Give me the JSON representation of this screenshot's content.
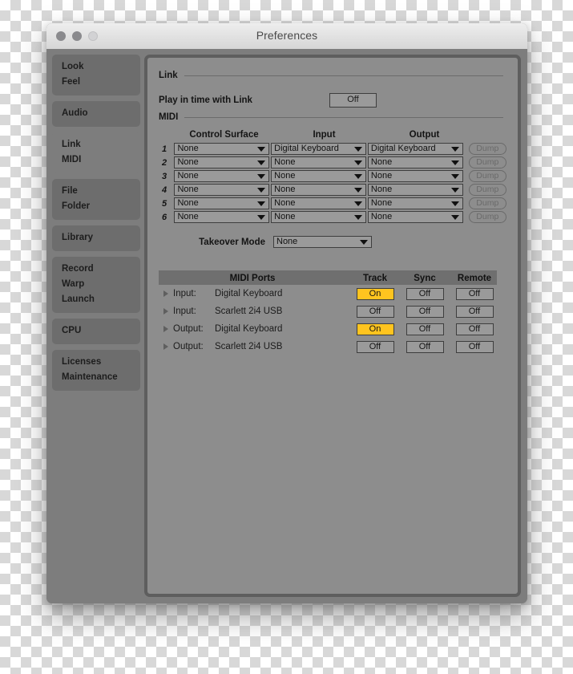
{
  "window": {
    "title": "Preferences",
    "traffic_lights": [
      "close-button",
      "minimize-button",
      "maximize-button"
    ]
  },
  "sidebar": {
    "groups": [
      {
        "name": "look-feel",
        "selected": false,
        "items": [
          "Look",
          "Feel"
        ]
      },
      {
        "name": "audio",
        "selected": false,
        "items": [
          "Audio"
        ]
      },
      {
        "name": "link-midi",
        "selected": true,
        "items": [
          "Link",
          "MIDI"
        ]
      },
      {
        "name": "file-folder",
        "selected": false,
        "items": [
          "File",
          "Folder"
        ]
      },
      {
        "name": "library",
        "selected": false,
        "items": [
          "Library"
        ]
      },
      {
        "name": "record-warp-launch",
        "selected": false,
        "items": [
          "Record",
          "Warp",
          "Launch"
        ]
      },
      {
        "name": "cpu",
        "selected": false,
        "items": [
          "CPU"
        ]
      },
      {
        "name": "licenses-maintenance",
        "selected": false,
        "items": [
          "Licenses",
          "Maintenance"
        ]
      }
    ]
  },
  "link_section": {
    "heading": "Link",
    "play_in_time_label": "Play in time with Link",
    "play_in_time_value": "Off"
  },
  "midi_section": {
    "heading": "MIDI",
    "columns": {
      "control_surface": "Control Surface",
      "input": "Input",
      "output": "Output"
    },
    "dump_label": "Dump",
    "rows": [
      {
        "num": "1",
        "control_surface": "None",
        "input": "Digital Keyboard",
        "output": "Digital Keyboard",
        "dump": "Dump"
      },
      {
        "num": "2",
        "control_surface": "None",
        "input": "None",
        "output": "None",
        "dump": "Dump"
      },
      {
        "num": "3",
        "control_surface": "None",
        "input": "None",
        "output": "None",
        "dump": "Dump"
      },
      {
        "num": "4",
        "control_surface": "None",
        "input": "None",
        "output": "None",
        "dump": "Dump"
      },
      {
        "num": "5",
        "control_surface": "None",
        "input": "None",
        "output": "None",
        "dump": "Dump"
      },
      {
        "num": "6",
        "control_surface": "None",
        "input": "None",
        "output": "None",
        "dump": "Dump"
      }
    ],
    "takeover_label": "Takeover Mode",
    "takeover_value": "None"
  },
  "midi_ports": {
    "title": "MIDI Ports",
    "col_track": "Track",
    "col_sync": "Sync",
    "col_remote": "Remote",
    "rows": [
      {
        "direction": "Input:",
        "name": "Digital Keyboard",
        "track": "On",
        "track_on": true,
        "sync": "Off",
        "remote": "Off"
      },
      {
        "direction": "Input:",
        "name": "Scarlett 2i4 USB",
        "track": "Off",
        "track_on": false,
        "sync": "Off",
        "remote": "Off"
      },
      {
        "direction": "Output:",
        "name": "Digital Keyboard",
        "track": "On",
        "track_on": true,
        "sync": "Off",
        "remote": "Off"
      },
      {
        "direction": "Output:",
        "name": "Scarlett 2i4 USB",
        "track": "Off",
        "track_on": false,
        "sync": "Off",
        "remote": "Off"
      }
    ]
  },
  "colors": {
    "window_bg": "#7d7d7d",
    "panel_bg": "#8d8d8d",
    "panel_border": "#5e5e5e",
    "sidebar_group": "#6d6d6d",
    "sidebar_selected": "#7d7d7d",
    "control_bg": "#9a9a9a",
    "accent_on": "#ffc41f",
    "titlebar_top": "#eeeeee",
    "titlebar_bottom": "#d6d6d6"
  }
}
